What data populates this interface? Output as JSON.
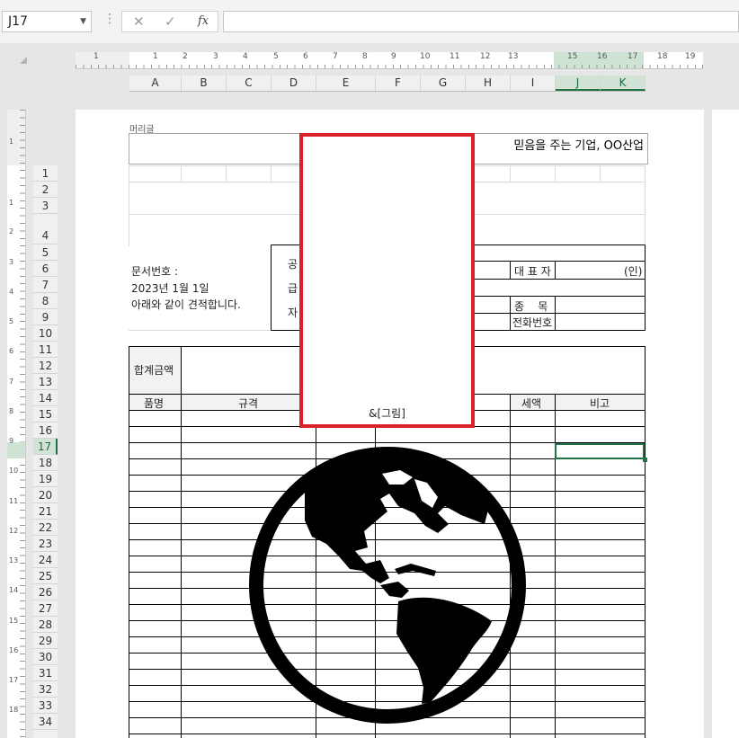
{
  "formula_bar": {
    "name_box": "J17",
    "cancel_icon": "✕",
    "enter_icon": "✓",
    "fx_label": "fx",
    "formula_value": ""
  },
  "ruler": {
    "ticks": [
      "1",
      "1",
      "2",
      "3",
      "4",
      "5",
      "6",
      "7",
      "8",
      "9",
      "10",
      "11",
      "12",
      "13",
      "15",
      "16",
      "17",
      "18",
      "19"
    ],
    "vticks": [
      "1",
      "1",
      "2",
      "3",
      "4",
      "5",
      "6",
      "7",
      "8",
      "9",
      "10",
      "11",
      "12",
      "13",
      "14",
      "15",
      "16",
      "17",
      "18"
    ]
  },
  "columns": [
    "A",
    "B",
    "C",
    "D",
    "E",
    "F",
    "G",
    "H",
    "I",
    "J",
    "K"
  ],
  "selected_columns": [
    "J",
    "K"
  ],
  "rows": [
    "1",
    "2",
    "3",
    "4",
    "5",
    "6",
    "7",
    "8",
    "9",
    "10",
    "11",
    "12",
    "13",
    "14",
    "15",
    "16",
    "17",
    "18",
    "19",
    "20",
    "21",
    "22",
    "23",
    "24",
    "25",
    "26",
    "27",
    "28",
    "29",
    "30",
    "31",
    "32",
    "33",
    "34"
  ],
  "selected_row": "17",
  "page_header": {
    "label": "머리글",
    "right_text": "믿음을 주는 기업, OO산업"
  },
  "doc": {
    "doc_number_label": "문서번호 :",
    "date": "2023년 1월 1일",
    "intro": "아래와 같이 견적합니다.",
    "supplier_partial": [
      "공",
      "급",
      "자"
    ],
    "ceo_label": "대 표 자",
    "seal_mark": "(인)",
    "category_label": "종    목",
    "phone_label": "전화번호",
    "total_label": "합계금액",
    "table_headers": {
      "item": "품명",
      "spec": "규격",
      "tax": "세액",
      "note": "비고"
    }
  },
  "image_placeholder": {
    "code": "&[그림]"
  },
  "colors": {
    "accent_green": "#217346",
    "red_border": "#d9202b"
  },
  "icons": [
    "globe-icon",
    "chevron-down-icon",
    "cancel-icon",
    "enter-icon",
    "function-icon"
  ]
}
